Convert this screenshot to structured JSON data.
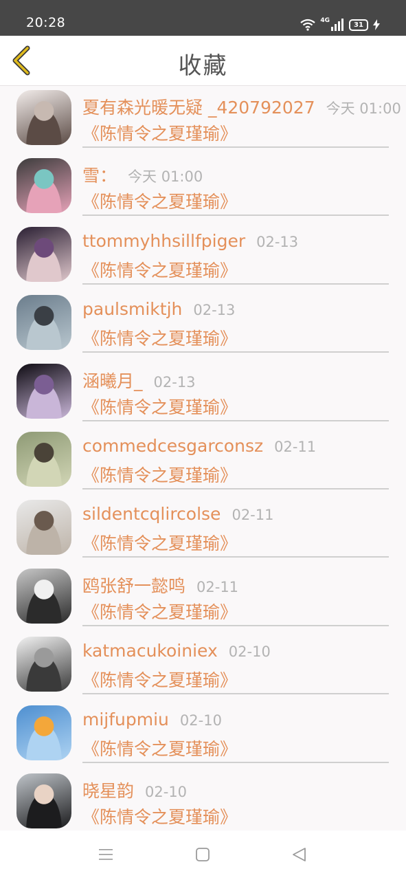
{
  "status": {
    "time": "20:28",
    "network": "4G",
    "battery": "31"
  },
  "nav": {
    "title": "收藏",
    "back_icon": "chevron-left-icon",
    "accent": "#e0bb1d"
  },
  "colors": {
    "name": "#e4905a",
    "time": "#b3b3b3"
  },
  "favorites": [
    {
      "user": "夏有森光暖无疑 _420792027",
      "time": "今天 01:00",
      "work": "《陈情令之夏瑾瑜》",
      "avatar_colors": [
        "#f2ecea",
        "#5b4b45",
        "#c7b9b1"
      ]
    },
    {
      "user": "雪：",
      "time": "今天 01:00",
      "work": "《陈情令之夏瑾瑜》",
      "avatar_colors": [
        "#3c3c3c",
        "#e6a2b8",
        "#7ac6c2"
      ]
    },
    {
      "user": "ttommyhhsillfpiger",
      "time": "02-13",
      "work": "《陈情令之夏瑾瑜》",
      "avatar_colors": [
        "#2a1f33",
        "#e0c8cc",
        "#6d4a7a"
      ]
    },
    {
      "user": "paulsmiktjh",
      "time": "02-13",
      "work": "《陈情令之夏瑾瑜》",
      "avatar_colors": [
        "#6b7d8c",
        "#b9c7cf",
        "#3a3f45"
      ]
    },
    {
      "user": "涵曦月_",
      "time": "02-13",
      "work": "《陈情令之夏瑾瑜》",
      "avatar_colors": [
        "#0e0b12",
        "#c9b6d8",
        "#7b5e93"
      ]
    },
    {
      "user": "commedcesgarconsz",
      "time": "02-11",
      "work": "《陈情令之夏瑾瑜》",
      "avatar_colors": [
        "#8e9a75",
        "#d2d6b6",
        "#4a4338"
      ]
    },
    {
      "user": "sildentcqlircolse",
      "time": "02-11",
      "work": "《陈情令之夏瑾瑜》",
      "avatar_colors": [
        "#e9e9e9",
        "#bdb3a8",
        "#6a5a4e"
      ]
    },
    {
      "user": "鸥张舒一懿鸣",
      "time": "02-11",
      "work": "《陈情令之夏瑾瑜》",
      "avatar_colors": [
        "#c7c7c7",
        "#2b2b2b",
        "#f0f0f0"
      ]
    },
    {
      "user": "katmacukoiniex",
      "time": "02-10",
      "work": "《陈情令之夏瑾瑜》",
      "avatar_colors": [
        "#f2f2f2",
        "#3a3a3a",
        "#9a9a9a"
      ]
    },
    {
      "user": "mijfupmiu",
      "time": "02-10",
      "work": "《陈情令之夏瑾瑜》",
      "avatar_colors": [
        "#4e8fd0",
        "#aed3f2",
        "#f3a73a"
      ]
    },
    {
      "user": "晓星韵",
      "time": "02-10",
      "work": "《陈情令之夏瑾瑜》",
      "avatar_colors": [
        "#bfc4c9",
        "#1c1c1e",
        "#e9d3c5"
      ]
    }
  ],
  "system_nav": {
    "menu_icon": "menu-icon",
    "home_icon": "home-icon",
    "back_icon": "back-triangle-icon"
  }
}
